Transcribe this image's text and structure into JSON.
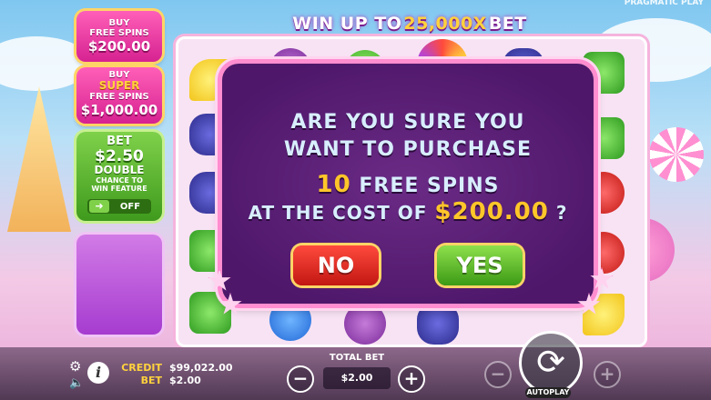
{
  "header": {
    "banner_prefix": "WIN UP TO",
    "banner_multiplier": "25,000X",
    "banner_suffix": "BET",
    "provider": "PRAGMATIC PLAY"
  },
  "side_panel": {
    "buy_free_spins": {
      "line1": "BUY",
      "line2": "FREE SPINS",
      "price": "$200.00"
    },
    "buy_super_free_spins": {
      "line1": "BUY",
      "line2": "SUPER",
      "line3": "FREE SPINS",
      "price": "$1,000.00"
    },
    "ante_bet": {
      "label": "BET",
      "amount": "$2.50",
      "line3": "DOUBLE",
      "line4": "CHANCE TO",
      "line5": "WIN FEATURE",
      "toggle_state": "OFF"
    }
  },
  "dialog": {
    "line1": "ARE YOU SURE YOU",
    "line2": "WANT TO PURCHASE",
    "spins_count": "10",
    "spins_label": "FREE SPINS",
    "cost_prefix": "AT THE COST OF",
    "cost_value": "$200.00",
    "cost_suffix": "?",
    "no_label": "NO",
    "yes_label": "YES"
  },
  "bottom_bar": {
    "credit_label": "CREDIT",
    "credit_value": "$99,022.00",
    "bet_label": "BET",
    "bet_value": "$2.00",
    "total_bet_label": "TOTAL BET",
    "total_bet_value": "$2.00",
    "minus": "−",
    "plus": "+",
    "autoplay_label": "AUTOPLAY",
    "settings_icon": "gear-icon",
    "sound_icon": "speaker-icon",
    "info_icon": "info-icon",
    "spin_icon": "spin-arrows-icon"
  },
  "colors": {
    "accent_gold": "#ffc629",
    "dialog_bg": "#4e176a",
    "no_button": "#c21712",
    "yes_button": "#3c9a15"
  }
}
